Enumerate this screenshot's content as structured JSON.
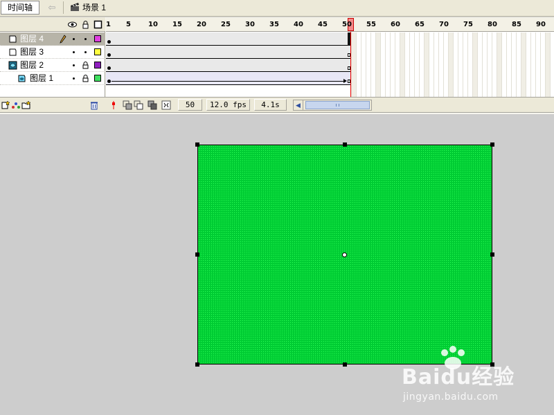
{
  "topbar": {
    "timeline_tab": "时间轴",
    "back_arrow": "⇦",
    "scene_label": "场景 1"
  },
  "layers": [
    {
      "name": "图层 4",
      "color": "#e040e0",
      "selected": true,
      "locked": false
    },
    {
      "name": "图层 3",
      "color": "#ffff40",
      "selected": false,
      "locked": false
    },
    {
      "name": "图层 2",
      "color": "#9020c0",
      "selected": false,
      "locked": true
    },
    {
      "name": "图层 1",
      "color": "#40e060",
      "selected": false,
      "locked": true
    }
  ],
  "ruler": {
    "ticks": [
      "1",
      "5",
      "10",
      "15",
      "20",
      "25",
      "30",
      "35",
      "40",
      "45",
      "50",
      "55",
      "60",
      "65",
      "70",
      "75",
      "80",
      "85",
      "90"
    ],
    "current_frame": 50
  },
  "footer": {
    "current_frame": "50",
    "fps": "12.0 fps",
    "time": "4.1s"
  },
  "stage": {
    "rect_color": "#00cc33"
  },
  "watermark": {
    "brand": "Baidu经验",
    "url": "jingyan.baidu.com"
  }
}
